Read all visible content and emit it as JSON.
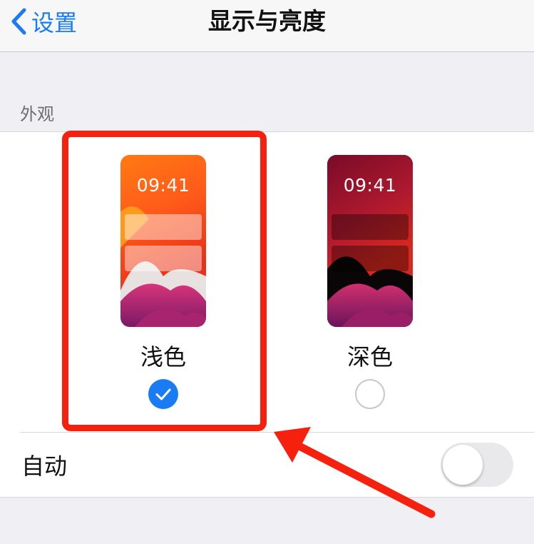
{
  "navbar": {
    "back_label": "设置",
    "title": "显示与亮度"
  },
  "appearance": {
    "section_header": "外观",
    "options": [
      {
        "label": "浅色",
        "time": "09:41",
        "selected": true
      },
      {
        "label": "深色",
        "time": "09:41",
        "selected": false
      }
    ]
  },
  "auto": {
    "label": "自动",
    "enabled": false
  },
  "colors": {
    "accent": "#1a7cf5",
    "annotation": "#f5210e",
    "background": "#efeff4"
  },
  "icons": {
    "back": "chevron-left-icon",
    "check": "checkmark-icon",
    "annotation_arrow": "arrow-icon"
  }
}
